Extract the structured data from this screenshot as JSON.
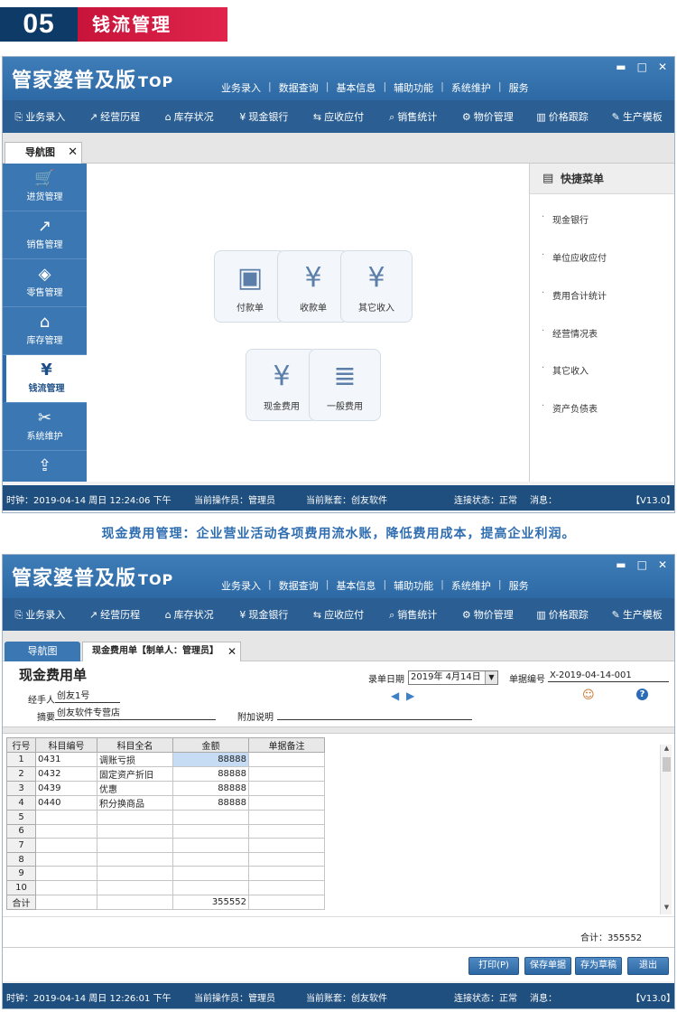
{
  "banner": {
    "number": "05",
    "title": "钱流管理"
  },
  "app": {
    "logo_main": "管家婆",
    "logo_sub": "普及版",
    "logo_top": "TOP",
    "menu": [
      "业务录入",
      "数据查询",
      "基本信息",
      "辅助功能",
      "系统维护",
      "服务"
    ],
    "menu_sep": "|",
    "window_controls": [
      "▬",
      "□",
      "✕"
    ],
    "toolbar": [
      {
        "icon": "⎘",
        "label": "业务录入"
      },
      {
        "icon": "↗",
        "label": "经营历程"
      },
      {
        "icon": "⌂",
        "label": "库存状况"
      },
      {
        "icon": "¥",
        "label": "现金银行"
      },
      {
        "icon": "⇆",
        "label": "应收应付"
      },
      {
        "icon": "⌕",
        "label": "销售统计"
      },
      {
        "icon": "⚙",
        "label": "物价管理"
      },
      {
        "icon": "▥",
        "label": "价格跟踪"
      },
      {
        "icon": "✎",
        "label": "生产模板"
      }
    ]
  },
  "window1": {
    "nav_tab": "导航图",
    "close_glyph": "✕",
    "sidebar": [
      {
        "icon": "🛒",
        "label": "进货管理"
      },
      {
        "icon": "↗",
        "label": "销售管理"
      },
      {
        "icon": "◈",
        "label": "零售管理"
      },
      {
        "icon": "⌂",
        "label": "库存管理"
      },
      {
        "icon": "¥",
        "label": "钱流管理"
      },
      {
        "icon": "✂",
        "label": "系统维护"
      },
      {
        "icon": "⇪",
        "label": ""
      }
    ],
    "tiles": [
      {
        "icon": "▣",
        "label": "付款单"
      },
      {
        "icon": "¥",
        "label": "收款单"
      },
      {
        "icon": "¥",
        "label": "其它收入"
      },
      {
        "icon": "¥",
        "label": "现金费用"
      },
      {
        "icon": "≣",
        "label": "一般费用"
      }
    ],
    "quick_menu": {
      "icon": "▤",
      "title": "快捷菜单",
      "items": [
        "现金银行",
        "单位应收应付",
        "费用合计统计",
        "经营情况表",
        "其它收入",
        "资产负债表"
      ]
    },
    "status": {
      "time": "时钟：2019-04-14 周日 12:24:06 下午",
      "operator": "当前操作员：管理员",
      "account": "当前账套：创友软件",
      "conn": "连接状态：正常",
      "msg": "消息：",
      "version": "【V13.0】"
    }
  },
  "caption": "现金费用管理：企业营业活动各项费用流水账，降低费用成本，提高企业利润。",
  "window2": {
    "tab_nav": "导航图",
    "tab_doc": "现金费用单【制单人：管理员】",
    "close_glyph": "✕",
    "form": {
      "title": "现金费用单",
      "date_label": "录单日期",
      "date_value": "2019年 4月14日",
      "dropdown_glyph": "▼",
      "docno_label": "单据编号",
      "docno_value": "X-2019-04-14-001",
      "handler_label": "经手人",
      "handler_value": "创友1号",
      "summary_label": "摘要",
      "summary_value": "创友软件专营店",
      "note_label": "附加说明",
      "note_value": "",
      "nav_prev": "◀",
      "nav_next": "▶",
      "person_icon": "☺",
      "help_icon": "?"
    },
    "grid": {
      "columns": [
        "行号",
        "科目编号",
        "科目全名",
        "金额",
        "单据备注"
      ],
      "rows": [
        {
          "no": "1",
          "code": "0431",
          "name": "调账亏损",
          "amount": "88888",
          "remark": ""
        },
        {
          "no": "2",
          "code": "0432",
          "name": "固定资产折旧",
          "amount": "88888",
          "remark": ""
        },
        {
          "no": "3",
          "code": "0439",
          "name": "优惠",
          "amount": "88888",
          "remark": ""
        },
        {
          "no": "4",
          "code": "0440",
          "name": "积分换商品",
          "amount": "88888",
          "remark": ""
        },
        {
          "no": "5",
          "code": "",
          "name": "",
          "amount": "",
          "remark": ""
        },
        {
          "no": "6",
          "code": "",
          "name": "",
          "amount": "",
          "remark": ""
        },
        {
          "no": "7",
          "code": "",
          "name": "",
          "amount": "",
          "remark": ""
        },
        {
          "no": "8",
          "code": "",
          "name": "",
          "amount": "",
          "remark": ""
        },
        {
          "no": "9",
          "code": "",
          "name": "",
          "amount": "",
          "remark": ""
        },
        {
          "no": "10",
          "code": "",
          "name": "",
          "amount": "",
          "remark": ""
        }
      ],
      "total_label": "合计",
      "total_amount": "355552",
      "scroll_up": "▲",
      "scroll_down": "▼"
    },
    "summary_total": "合计：355552",
    "buttons": [
      "打印(P)",
      "保存单据",
      "存为草稿",
      "退出"
    ],
    "status": {
      "time": "时钟：2019-04-14 周日 12:26:01 下午",
      "operator": "当前操作员：管理员",
      "account": "当前账套：创友软件",
      "conn": "连接状态：正常",
      "msg": "消息：",
      "version": "【V13.0】"
    }
  }
}
